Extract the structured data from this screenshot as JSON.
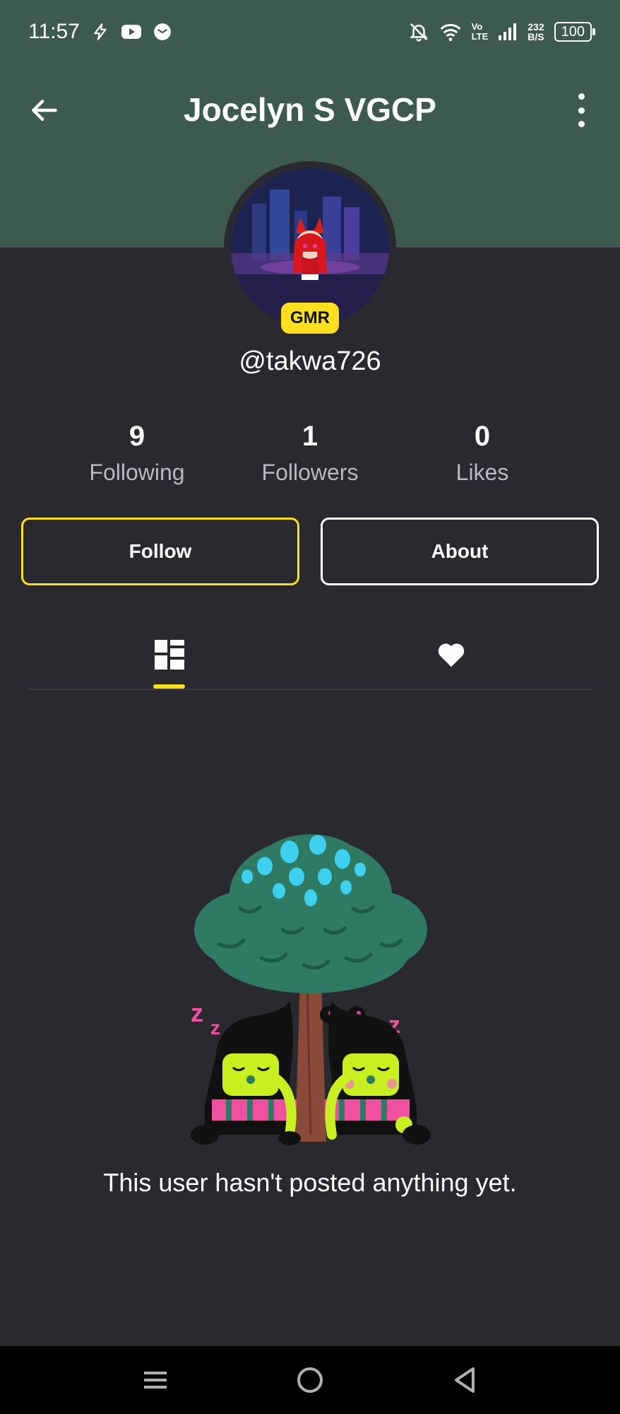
{
  "status_bar": {
    "time": "11:57",
    "net_speed_value": "232",
    "net_speed_unit": "B/S",
    "volte_top": "Vo",
    "volte_bottom": "LTE",
    "battery": "100"
  },
  "header": {
    "title": "Jocelyn S  VGCP",
    "badge": "GMR"
  },
  "profile": {
    "username": "@takwa726"
  },
  "stats": [
    {
      "value": "9",
      "label": "Following"
    },
    {
      "value": "1",
      "label": "Followers"
    },
    {
      "value": "0",
      "label": "Likes"
    }
  ],
  "actions": {
    "follow_label": "Follow",
    "about_label": "About"
  },
  "tabs": {
    "active": "posts",
    "items": [
      {
        "id": "posts",
        "icon": "grid-icon"
      },
      {
        "id": "likes",
        "icon": "heart-icon"
      }
    ]
  },
  "empty_state": {
    "message": "This user hasn't posted anything yet."
  },
  "colors": {
    "header_bg": "#3d5a4e",
    "page_bg": "#2a2930",
    "accent": "#ffe020"
  }
}
